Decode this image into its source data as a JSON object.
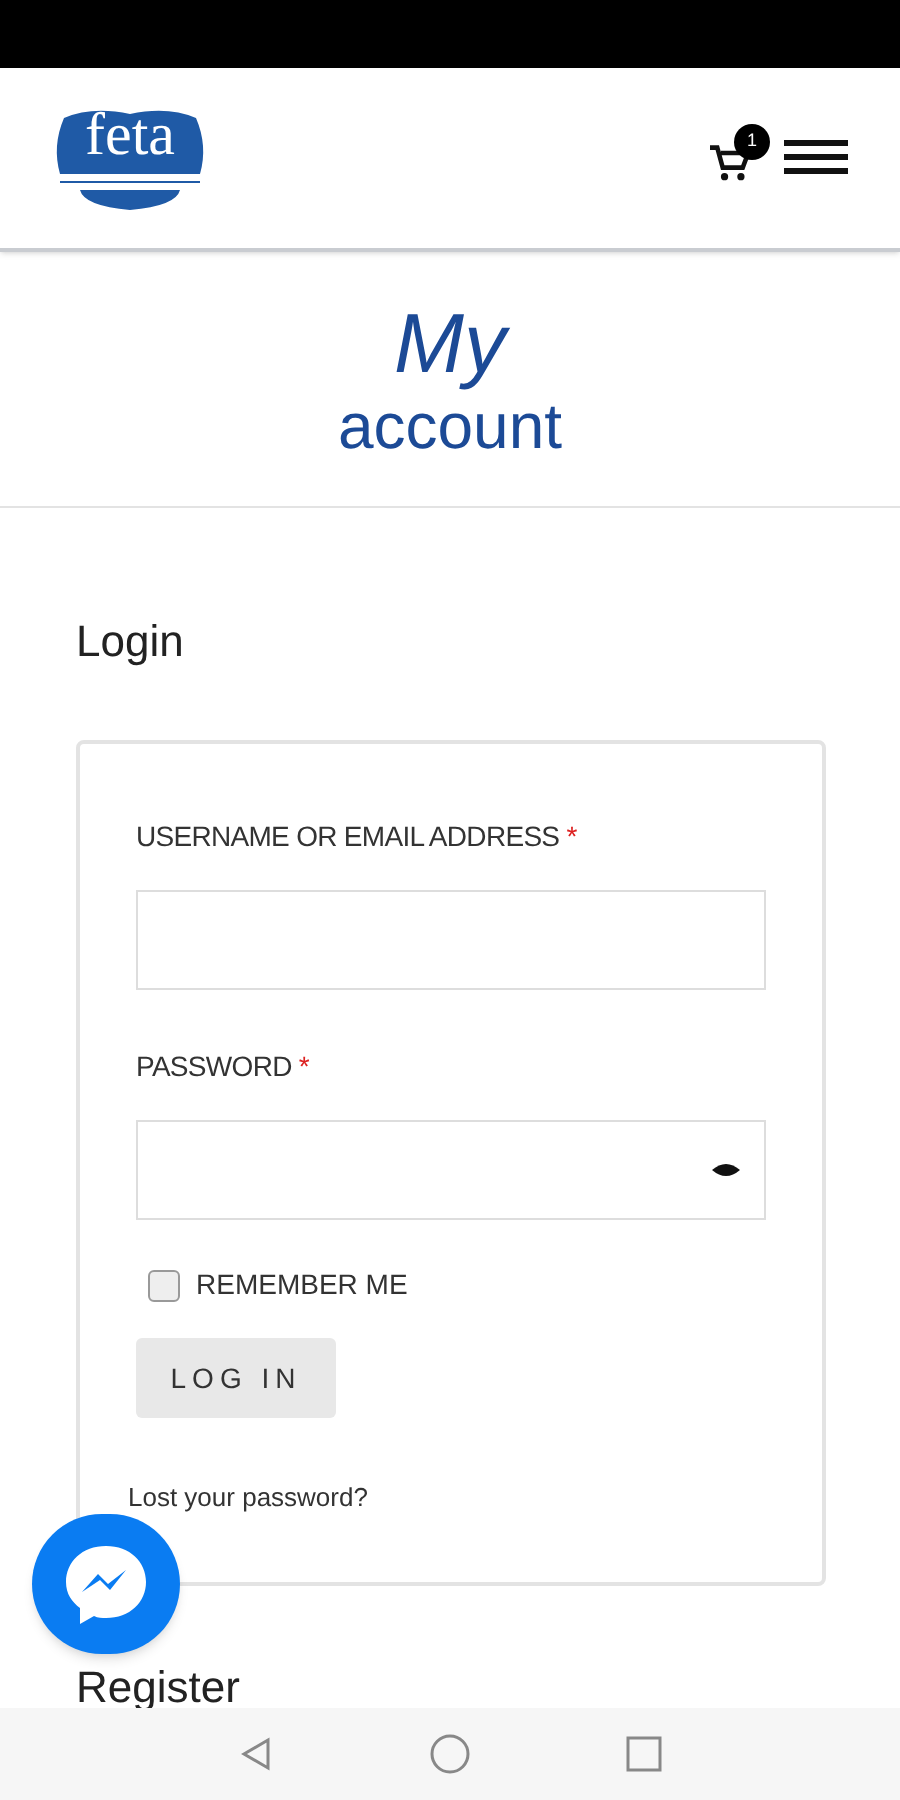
{
  "header": {
    "logo_text": "feta",
    "cart_count": "1"
  },
  "title": {
    "line_1": "My",
    "line_2": "account"
  },
  "login": {
    "heading": "Login",
    "fields": [
      {
        "label": "USERNAME OR EMAIL ADDRESS",
        "required_mark": "*",
        "kind": "text"
      },
      {
        "label": "PASSWORD",
        "required_mark": "*",
        "kind": "password"
      }
    ],
    "remember": {
      "label": "REMEMBER ME",
      "checked": false
    },
    "button": "LOG IN",
    "lost_link": "Lost your password?"
  },
  "register_heading": "Register"
}
